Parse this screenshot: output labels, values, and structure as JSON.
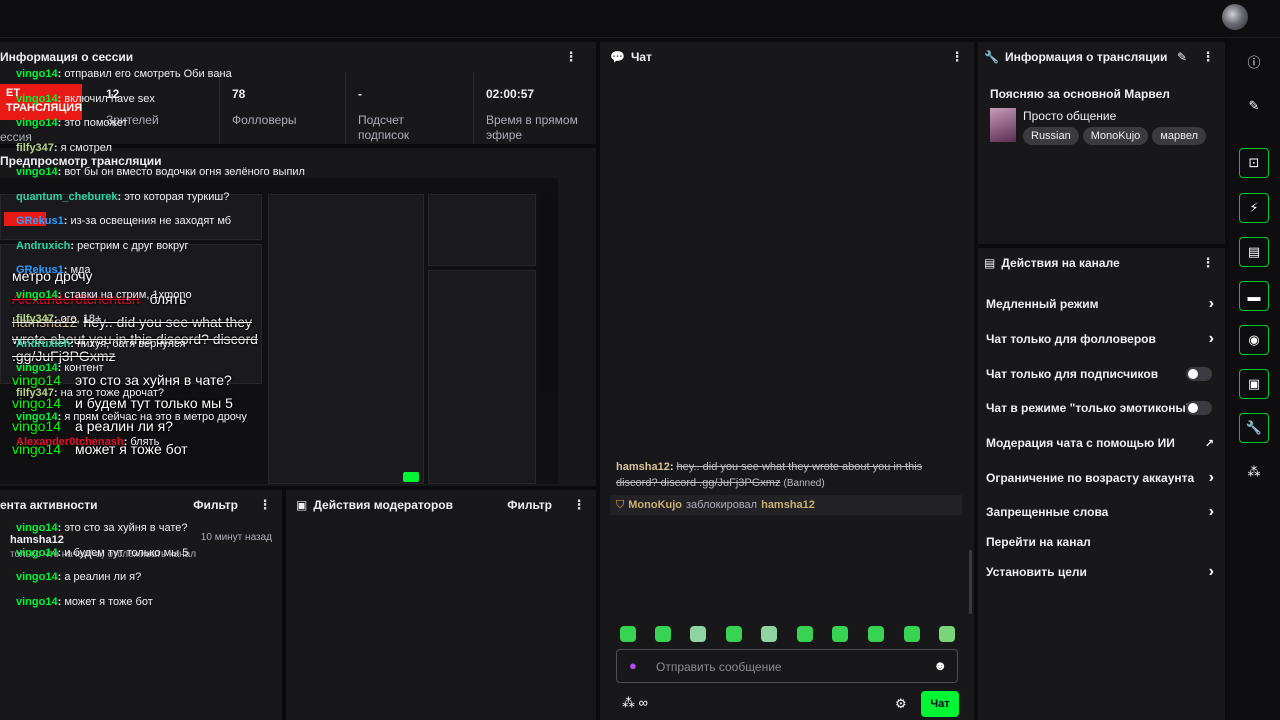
{
  "session": {
    "title": "Информация о сессии",
    "live_badge": "ЕТ\nТРАНСЛЯЦИЯ",
    "live_label": "ессия",
    "stats": [
      {
        "value": "12",
        "label": "Зрителей"
      },
      {
        "value": "78",
        "label": "Фолловеры"
      },
      {
        "value": "-",
        "label": "Подсчет подписок"
      },
      {
        "value": "02:00:57",
        "label": "Время в прямом эфире"
      }
    ]
  },
  "preview": {
    "title": "Предпросмотр трансляции",
    "overlay": {
      "top_text": "метро дрочу",
      "struck_user": "Alexander0tchenash",
      "struck_text": "блять",
      "lines": [
        {
          "user": "hamsha12",
          "text": "hey.. did you see what they wrote about you in this discord? discord .gg/JuFj3PGxmz",
          "struck": true
        },
        {
          "user": "vingo14",
          "text": "это сто за хуйня в чате?"
        },
        {
          "user": "vingo14",
          "text": "и будем тут только мы 5"
        },
        {
          "user": "vingo14",
          "text": "а реалин ли я?"
        },
        {
          "user": "vingo14",
          "text": "может я тоже бот"
        }
      ]
    }
  },
  "activity": {
    "title": "ента активности",
    "filter": "Фильтр",
    "items": [
      {
        "user": "hamsha12",
        "time": "10 минут назад",
        "desc": "только что начал(-а) отслеживать канал"
      }
    ]
  },
  "mod_actions": {
    "title": "Действия модераторов",
    "filter": "Фильтр"
  },
  "chat": {
    "title": "Чат",
    "messages": [
      {
        "user": "vingo14",
        "color": "green",
        "text": "отправил его смотреть Оби вана"
      },
      {
        "user": "vingo14",
        "color": "green",
        "text": "включил have sex"
      },
      {
        "user": "vingo14",
        "color": "green",
        "text": "это поможет"
      },
      {
        "user": "filfy347",
        "color": "olive",
        "text": "я смотрел"
      },
      {
        "user": "vingo14",
        "color": "green",
        "text": "вот бы он вместо водочки огня зелёного выпил"
      },
      {
        "user": "quantum_cheburek",
        "color": "teal",
        "text": "это которая туркиш?"
      },
      {
        "user": "GRekus1",
        "color": "blue",
        "text": "из-за освещения не заходят мб"
      },
      {
        "user": "Andruxich",
        "color": "teal",
        "text": "рестрим с друг вокруг"
      },
      {
        "user": "GRekus1",
        "color": "blue",
        "text": "мда"
      },
      {
        "user": "vingo14",
        "color": "green",
        "text": "ставки на стрим, 1xmono"
      },
      {
        "user": "filfy347",
        "color": "olive",
        "text": "ого, 18+"
      },
      {
        "user": "Andruxich",
        "color": "teal",
        "text": "нихуя, батя вернулся"
      },
      {
        "user": "vingo14",
        "color": "green",
        "text": "контент"
      },
      {
        "user": "filfy347",
        "color": "olive",
        "text": "на это тоже дрочат?"
      },
      {
        "user": "vingo14",
        "color": "green",
        "text": "я прям сейчас на это в метро дрочу"
      },
      {
        "user": "Alexander0tchenash",
        "color": "red",
        "text": "блять"
      }
    ],
    "banned_msg": {
      "user": "hamsha12",
      "line1": "hey.. did you see what they wrote about you in this",
      "line2": "discord? discord .gg/JuFj3PGxmz",
      "tag": "(Banned)"
    },
    "mod_notice": {
      "mod": "MonoKujo",
      "action": "заблокировал",
      "target": "hamsha12"
    },
    "after": [
      {
        "user": "vingo14",
        "text": "это сто за хуйня в чате?"
      },
      {
        "user": "vingo14",
        "text": "и будем тут только мы 5"
      },
      {
        "user": "vingo14",
        "text": "а реалин ли я?"
      },
      {
        "user": "vingo14",
        "text": "может я тоже бот"
      }
    ],
    "placeholder": "Отправить сообщение",
    "send_label": "Чат",
    "points_label": "∞"
  },
  "stream_info": {
    "title": "Информация о трансляции",
    "stream_title": "Поясняю за основной Марвел",
    "category": "Просто общение",
    "tags": [
      "Russian",
      "MonoKujo",
      "марвел"
    ]
  },
  "channel_actions": {
    "title": "Действия на канале",
    "items": [
      {
        "label": "Медленный режим",
        "control": "chevron"
      },
      {
        "label": "Чат только для фолловеров",
        "control": "chevron"
      },
      {
        "label": "Чат только для подписчиков",
        "control": "toggle"
      },
      {
        "label": "Чат в режиме \"только эмотиконы\"",
        "control": "toggle"
      },
      {
        "label": "Модерация чата с помощью ИИ",
        "control": "external"
      },
      {
        "label": "Ограничение по возрасту аккаунта",
        "control": "chevron"
      },
      {
        "label": "Запрещенные слова",
        "control": "chevron"
      },
      {
        "label": "Перейти на канал",
        "control": "none"
      },
      {
        "label": "Установить цели",
        "control": "chevron"
      }
    ]
  },
  "colors": {
    "accent": "#00f535",
    "live": "#e91916",
    "panel": "#18181b",
    "bg": "#0b0b0d"
  }
}
